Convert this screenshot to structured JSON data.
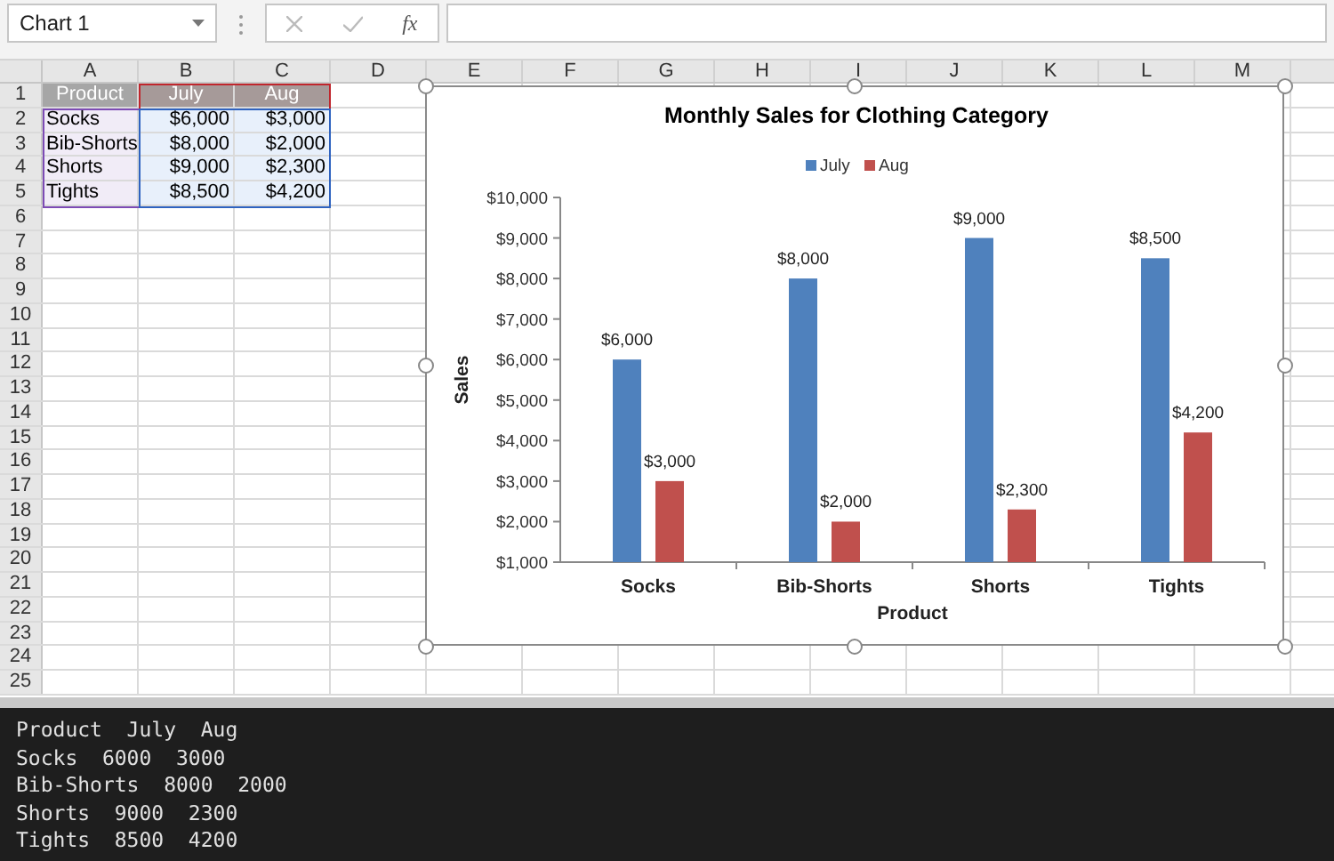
{
  "name_box": {
    "value": "Chart 1"
  },
  "formula_bar": {
    "function_label": "fx"
  },
  "sheet": {
    "columns": [
      "A",
      "B",
      "C",
      "D",
      "E",
      "F",
      "G",
      "H",
      "I",
      "J",
      "K",
      "L",
      "M"
    ],
    "row_numbers": [
      "1",
      "2",
      "3",
      "4",
      "5",
      "6",
      "7",
      "8",
      "9",
      "10",
      "11",
      "12",
      "13",
      "14",
      "15",
      "16",
      "17",
      "18",
      "19",
      "20",
      "21",
      "22",
      "23",
      "24",
      "25"
    ],
    "rows": [
      {
        "kind": "header",
        "cells": [
          "Product",
          "July",
          "Aug"
        ]
      },
      {
        "kind": "data",
        "cells": [
          "Socks",
          "$6,000",
          "$3,000"
        ]
      },
      {
        "kind": "data",
        "cells": [
          "Bib-Shorts",
          "$8,000",
          "$2,000"
        ]
      },
      {
        "kind": "data",
        "cells": [
          "Shorts",
          "$9,000",
          "$2,300"
        ]
      },
      {
        "kind": "data",
        "cells": [
          "Tights",
          "$8,500",
          "$4,200"
        ]
      }
    ]
  },
  "chart": {
    "chart_data": {
      "type": "bar",
      "title": "Monthly Sales for Clothing Category",
      "xlabel": "Product",
      "ylabel": "Sales",
      "categories": [
        "Socks",
        "Bib-Shorts",
        "Shorts",
        "Tights"
      ],
      "series": [
        {
          "name": "July",
          "color": "#4f81bd",
          "values": [
            6000,
            8000,
            9000,
            8500
          ],
          "value_labels": [
            "$6,000",
            "$8,000",
            "$9,000",
            "$8,500"
          ]
        },
        {
          "name": "Aug",
          "color": "#c0504d",
          "values": [
            3000,
            2000,
            2300,
            4200
          ],
          "value_labels": [
            "$3,000",
            "$2,000",
            "$2,300",
            "$4,200"
          ]
        }
      ],
      "ylim": [
        1000,
        10000
      ],
      "yticks": [
        {
          "value": 1000,
          "label": "$1,000"
        },
        {
          "value": 2000,
          "label": "$2,000"
        },
        {
          "value": 3000,
          "label": "$3,000"
        },
        {
          "value": 4000,
          "label": "$4,000"
        },
        {
          "value": 5000,
          "label": "$5,000"
        },
        {
          "value": 6000,
          "label": "$6,000"
        },
        {
          "value": 7000,
          "label": "$7,000"
        },
        {
          "value": 8000,
          "label": "$8,000"
        },
        {
          "value": 9000,
          "label": "$9,000"
        },
        {
          "value": 10000,
          "label": "$10,000"
        }
      ],
      "data_labels": true,
      "legend": "top"
    }
  },
  "console": {
    "lines": [
      "Product  July  Aug",
      "Socks  6000  3000",
      "Bib-Shorts  8000  2000",
      "Shorts  9000  2300",
      "Tights  8500  4200"
    ]
  }
}
